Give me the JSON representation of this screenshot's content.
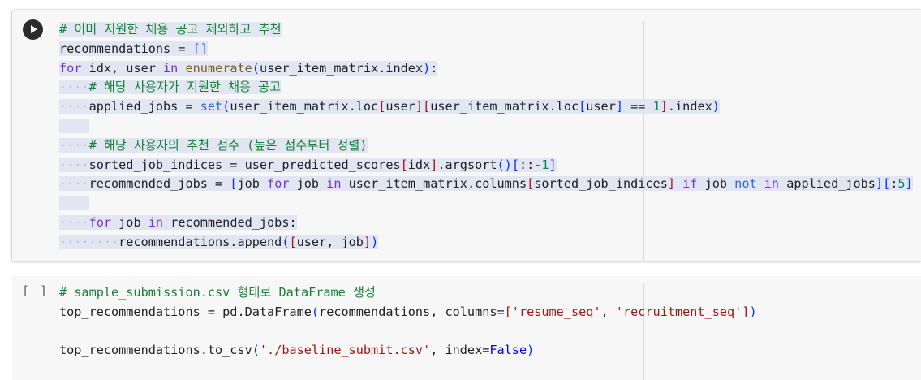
{
  "cell1": {
    "run_button_label": "",
    "lines": [
      {
        "indent": "",
        "tokens": [
          {
            "t": "# 이미 지원한 채용 공고 제외하고 추천",
            "c": "c-cm"
          }
        ]
      },
      {
        "indent": "",
        "tokens": [
          {
            "t": "recommendations = ",
            "c": ""
          },
          {
            "t": "[]",
            "c": "c-br"
          }
        ]
      },
      {
        "indent": "",
        "tokens": [
          {
            "t": "for",
            "c": "c-kw"
          },
          {
            "t": " idx, user ",
            "c": ""
          },
          {
            "t": "in",
            "c": "c-kw"
          },
          {
            "t": " ",
            "c": ""
          },
          {
            "t": "enumerate",
            "c": "c-fn"
          },
          {
            "t": "(",
            "c": "c-br"
          },
          {
            "t": "user_item_matrix.index",
            "c": ""
          },
          {
            "t": ")",
            "c": "c-br"
          },
          {
            "t": ":",
            "c": ""
          }
        ]
      },
      {
        "indent": "····",
        "tokens": [
          {
            "t": "# 해당 사용자가 지원한 채용 공고",
            "c": "c-cm"
          }
        ]
      },
      {
        "indent": "····",
        "tokens": [
          {
            "t": "applied_jobs = ",
            "c": ""
          },
          {
            "t": "set",
            "c": "c-bi"
          },
          {
            "t": "(",
            "c": "c-br"
          },
          {
            "t": "user_item_matrix.loc",
            "c": ""
          },
          {
            "t": "[",
            "c": "c-red"
          },
          {
            "t": "user",
            "c": ""
          },
          {
            "t": "][",
            "c": "c-red"
          },
          {
            "t": "user_item_matrix.loc",
            "c": ""
          },
          {
            "t": "[",
            "c": "c-br"
          },
          {
            "t": "user",
            "c": ""
          },
          {
            "t": "]",
            "c": "c-br"
          },
          {
            "t": " == ",
            "c": ""
          },
          {
            "t": "1",
            "c": "c-num"
          },
          {
            "t": "]",
            "c": "c-red"
          },
          {
            "t": ".index",
            "c": ""
          },
          {
            "t": ")",
            "c": "c-br"
          }
        ]
      },
      {
        "indent": "",
        "tokens": [
          {
            "t": "    ",
            "c": ""
          }
        ]
      },
      {
        "indent": "····",
        "tokens": [
          {
            "t": "# 해당 사용자의 추천 점수 (높은 점수부터 정렬)",
            "c": "c-cm"
          }
        ]
      },
      {
        "indent": "····",
        "tokens": [
          {
            "t": "sorted_job_indices = user_predicted_scores",
            "c": ""
          },
          {
            "t": "[",
            "c": "c-red"
          },
          {
            "t": "idx",
            "c": ""
          },
          {
            "t": "]",
            "c": "c-red"
          },
          {
            "t": ".argsort",
            "c": ""
          },
          {
            "t": "()[",
            "c": "c-br"
          },
          {
            "t": "::-",
            "c": ""
          },
          {
            "t": "1",
            "c": "c-num"
          },
          {
            "t": "]",
            "c": "c-br"
          }
        ]
      },
      {
        "indent": "····",
        "tokens": [
          {
            "t": "recommended_jobs = ",
            "c": ""
          },
          {
            "t": "[",
            "c": "c-br"
          },
          {
            "t": "job ",
            "c": ""
          },
          {
            "t": "for",
            "c": "c-kw"
          },
          {
            "t": " job ",
            "c": ""
          },
          {
            "t": "in",
            "c": "c-kw"
          },
          {
            "t": " user_item_matrix.columns",
            "c": ""
          },
          {
            "t": "[",
            "c": "c-red"
          },
          {
            "t": "sorted_job_indices",
            "c": ""
          },
          {
            "t": "]",
            "c": "c-red"
          },
          {
            "t": " ",
            "c": ""
          },
          {
            "t": "if",
            "c": "c-kw"
          },
          {
            "t": " job ",
            "c": ""
          },
          {
            "t": "not",
            "c": "c-bi"
          },
          {
            "t": " ",
            "c": ""
          },
          {
            "t": "in",
            "c": "c-kw"
          },
          {
            "t": " applied_jobs",
            "c": ""
          },
          {
            "t": "][",
            "c": "c-br"
          },
          {
            "t": ":",
            "c": ""
          },
          {
            "t": "5",
            "c": "c-num"
          },
          {
            "t": "]",
            "c": "c-br"
          }
        ]
      },
      {
        "indent": "",
        "tokens": [
          {
            "t": "    ",
            "c": ""
          }
        ]
      },
      {
        "indent": "····",
        "tokens": [
          {
            "t": "for",
            "c": "c-kw"
          },
          {
            "t": " job ",
            "c": ""
          },
          {
            "t": "in",
            "c": "c-kw"
          },
          {
            "t": " recommended_jobs:",
            "c": ""
          }
        ]
      },
      {
        "indent": "········",
        "tokens": [
          {
            "t": "recommendations.append",
            "c": ""
          },
          {
            "t": "(",
            "c": "c-br"
          },
          {
            "t": "[",
            "c": "c-red"
          },
          {
            "t": "user, job",
            "c": ""
          },
          {
            "t": "]",
            "c": "c-red"
          },
          {
            "t": ")",
            "c": "c-br"
          }
        ]
      }
    ]
  },
  "cell2": {
    "exec_count": "[ ]",
    "lines": [
      {
        "indent": "",
        "tokens": [
          {
            "t": "# sample_submission.csv 형태로 DataFrame 생성",
            "c": "c-cm"
          }
        ]
      },
      {
        "indent": "",
        "tokens": [
          {
            "t": "top_recommendations = pd.DataFrame",
            "c": ""
          },
          {
            "t": "(",
            "c": "c-br"
          },
          {
            "t": "recommendations, columns=",
            "c": ""
          },
          {
            "t": "[",
            "c": "c-red"
          },
          {
            "t": "'resume_seq'",
            "c": "c-str"
          },
          {
            "t": ", ",
            "c": ""
          },
          {
            "t": "'recruitment_seq'",
            "c": "c-str"
          },
          {
            "t": "]",
            "c": "c-red"
          },
          {
            "t": ")",
            "c": "c-br"
          }
        ]
      },
      {
        "indent": "",
        "tokens": []
      },
      {
        "indent": "",
        "tokens": [
          {
            "t": "top_recommendations.to_csv",
            "c": ""
          },
          {
            "t": "(",
            "c": "c-br"
          },
          {
            "t": "'./baseline_submit.csv'",
            "c": "c-str"
          },
          {
            "t": ", index=",
            "c": ""
          },
          {
            "t": "False",
            "c": "c-bool"
          },
          {
            "t": ")",
            "c": "c-br"
          }
        ]
      }
    ]
  }
}
